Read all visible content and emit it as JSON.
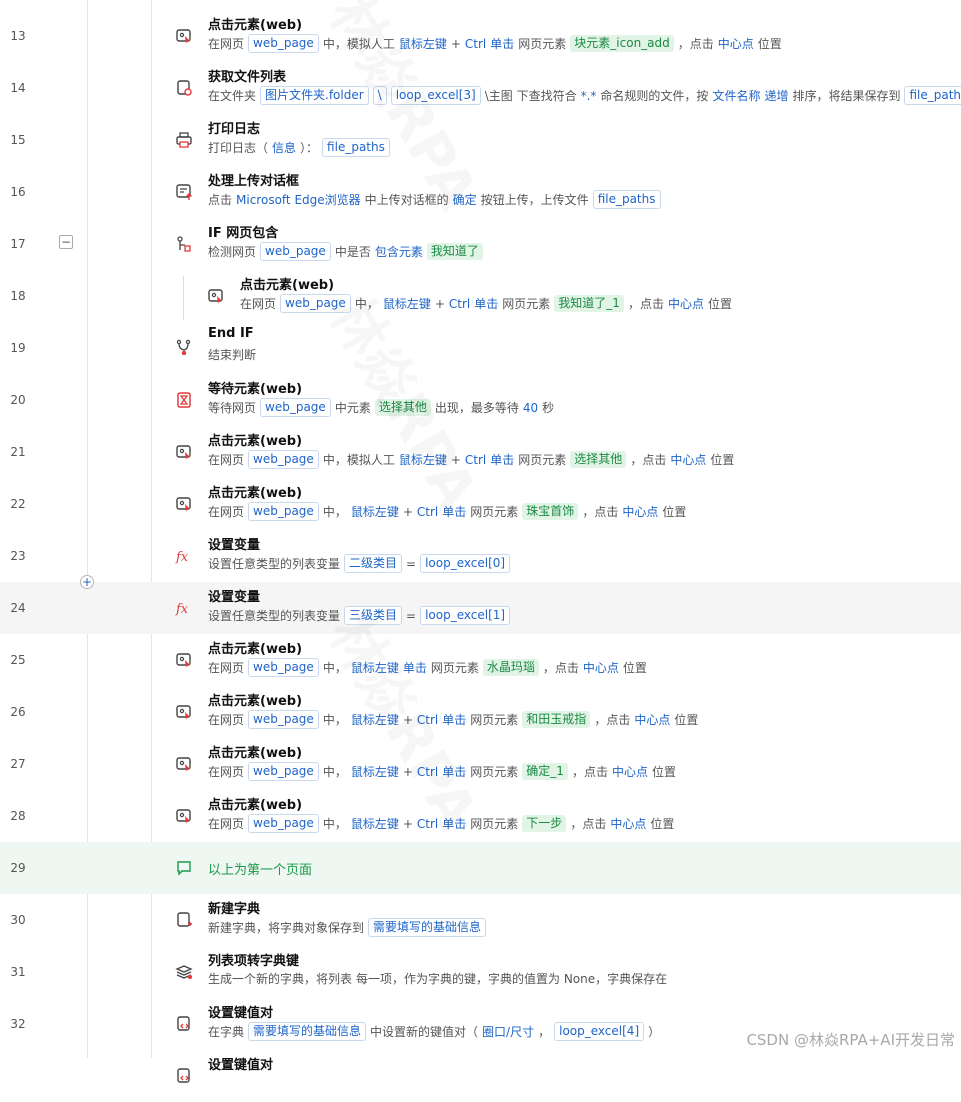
{
  "rows": [
    {
      "num": "13",
      "title": "点击元素(web)",
      "desc": [
        [
          "t",
          "在网页"
        ],
        [
          "tag",
          "web_page"
        ],
        [
          "t",
          "中，模拟人工"
        ],
        [
          "kw",
          "鼠标左键"
        ],
        [
          "t",
          "+"
        ],
        [
          "kw",
          "Ctrl"
        ],
        [
          "kw",
          "单击"
        ],
        [
          "t",
          "网页元素"
        ],
        [
          "el",
          "块元素_icon_add"
        ],
        [
          "t",
          "，点击"
        ],
        [
          "kw",
          "中心点"
        ],
        [
          "t",
          "位置"
        ]
      ]
    },
    {
      "num": "14",
      "title": "获取文件列表",
      "desc": [
        [
          "t",
          "在文件夹"
        ],
        [
          "tag",
          "图片文件夹.folder"
        ],
        [
          "tag",
          "\\"
        ],
        [
          "tag",
          "loop_excel[3]"
        ],
        [
          "t",
          "\\主图 下查找符合"
        ],
        [
          "kw",
          "*.*"
        ],
        [
          "t",
          "命名规则的文件，按"
        ],
        [
          "kw",
          "文件名称"
        ],
        [
          "kw",
          "递增"
        ],
        [
          "t",
          "排序，将结果保存到"
        ],
        [
          "tag",
          "file_paths"
        ]
      ]
    },
    {
      "num": "15",
      "title": "打印日志",
      "desc": [
        [
          "t",
          "打印日志（"
        ],
        [
          "kw",
          "信息"
        ],
        [
          "t",
          "）："
        ],
        [
          "tag",
          "file_paths"
        ]
      ]
    },
    {
      "num": "16",
      "title": "处理上传对话框",
      "desc": [
        [
          "t",
          "点击"
        ],
        [
          "kw",
          "Microsoft Edge浏览器"
        ],
        [
          "t",
          "中上传对话框的"
        ],
        [
          "kw",
          "确定"
        ],
        [
          "t",
          "按钮上传，上传文件"
        ],
        [
          "tag",
          "file_paths"
        ]
      ]
    },
    {
      "num": "17",
      "title": "IF 网页包含",
      "desc": [
        [
          "t",
          "检测网页"
        ],
        [
          "tag",
          "web_page"
        ],
        [
          "t",
          "中是否"
        ],
        [
          "kw",
          "包含元素"
        ],
        [
          "el",
          "我知道了"
        ]
      ]
    },
    {
      "num": "18",
      "title": "点击元素(web)",
      "desc": [
        [
          "t",
          "在网页"
        ],
        [
          "tag",
          "web_page"
        ],
        [
          "t",
          "中，"
        ],
        [
          "kw",
          "鼠标左键"
        ],
        [
          "t",
          "+"
        ],
        [
          "kw",
          "Ctrl"
        ],
        [
          "kw",
          "单击"
        ],
        [
          "t",
          "网页元素"
        ],
        [
          "el",
          "我知道了_1"
        ],
        [
          "t",
          "，点击"
        ],
        [
          "kw",
          "中心点"
        ],
        [
          "t",
          "位置"
        ]
      ]
    },
    {
      "num": "19",
      "title": "End IF",
      "desc": [
        [
          "t",
          "结束判断"
        ]
      ]
    },
    {
      "num": "20",
      "title": "等待元素(web)",
      "desc": [
        [
          "t",
          "等待网页"
        ],
        [
          "tag",
          "web_page"
        ],
        [
          "t",
          "中元素"
        ],
        [
          "el",
          "选择其他"
        ],
        [
          "t",
          "出现，最多等待"
        ],
        [
          "kw",
          "40"
        ],
        [
          "t",
          "秒"
        ]
      ]
    },
    {
      "num": "21",
      "title": "点击元素(web)",
      "desc": [
        [
          "t",
          "在网页"
        ],
        [
          "tag",
          "web_page"
        ],
        [
          "t",
          "中，模拟人工"
        ],
        [
          "kw",
          "鼠标左键"
        ],
        [
          "t",
          "+"
        ],
        [
          "kw",
          "Ctrl"
        ],
        [
          "kw",
          "单击"
        ],
        [
          "t",
          "网页元素"
        ],
        [
          "el",
          "选择其他"
        ],
        [
          "t",
          "，点击"
        ],
        [
          "kw",
          "中心点"
        ],
        [
          "t",
          "位置"
        ]
      ]
    },
    {
      "num": "22",
      "title": "点击元素(web)",
      "desc": [
        [
          "t",
          "在网页"
        ],
        [
          "tag",
          "web_page"
        ],
        [
          "t",
          "中，"
        ],
        [
          "kw",
          "鼠标左键"
        ],
        [
          "t",
          "+"
        ],
        [
          "kw",
          "Ctrl"
        ],
        [
          "kw",
          "单击"
        ],
        [
          "t",
          "网页元素"
        ],
        [
          "el",
          "珠宝首饰"
        ],
        [
          "t",
          "，点击"
        ],
        [
          "kw",
          "中心点"
        ],
        [
          "t",
          "位置"
        ]
      ]
    },
    {
      "num": "23",
      "title": "设置变量",
      "desc": [
        [
          "t",
          "设置任意类型的列表变量"
        ],
        [
          "tag",
          "二级类目"
        ],
        [
          "t",
          "="
        ],
        [
          "tag",
          "loop_excel[0]"
        ]
      ]
    },
    {
      "num": "24",
      "title": "设置变量",
      "desc": [
        [
          "t",
          "设置任意类型的列表变量"
        ],
        [
          "tag",
          "三级类目"
        ],
        [
          "t",
          "="
        ],
        [
          "tag",
          "loop_excel[1]"
        ]
      ]
    },
    {
      "num": "25",
      "title": "点击元素(web)",
      "desc": [
        [
          "t",
          "在网页"
        ],
        [
          "tag",
          "web_page"
        ],
        [
          "t",
          "中，"
        ],
        [
          "kw",
          "鼠标左键"
        ],
        [
          "kw",
          "单击"
        ],
        [
          "t",
          "网页元素"
        ],
        [
          "el",
          "水晶玛瑙"
        ],
        [
          "t",
          "，点击"
        ],
        [
          "kw",
          "中心点"
        ],
        [
          "t",
          "位置"
        ]
      ]
    },
    {
      "num": "26",
      "title": "点击元素(web)",
      "desc": [
        [
          "t",
          "在网页"
        ],
        [
          "tag",
          "web_page"
        ],
        [
          "t",
          "中，"
        ],
        [
          "kw",
          "鼠标左键"
        ],
        [
          "t",
          "+"
        ],
        [
          "kw",
          "Ctrl"
        ],
        [
          "kw",
          "单击"
        ],
        [
          "t",
          "网页元素"
        ],
        [
          "el",
          "和田玉戒指"
        ],
        [
          "t",
          "，点击"
        ],
        [
          "kw",
          "中心点"
        ],
        [
          "t",
          "位置"
        ]
      ]
    },
    {
      "num": "27",
      "title": "点击元素(web)",
      "desc": [
        [
          "t",
          "在网页"
        ],
        [
          "tag",
          "web_page"
        ],
        [
          "t",
          "中，"
        ],
        [
          "kw",
          "鼠标左键"
        ],
        [
          "t",
          "+"
        ],
        [
          "kw",
          "Ctrl"
        ],
        [
          "kw",
          "单击"
        ],
        [
          "t",
          "网页元素"
        ],
        [
          "el",
          "确定_1"
        ],
        [
          "t",
          "，点击"
        ],
        [
          "kw",
          "中心点"
        ],
        [
          "t",
          "位置"
        ]
      ]
    },
    {
      "num": "28",
      "title": "点击元素(web)",
      "desc": [
        [
          "t",
          "在网页"
        ],
        [
          "tag",
          "web_page"
        ],
        [
          "t",
          "中，"
        ],
        [
          "kw",
          "鼠标左键"
        ],
        [
          "t",
          "+"
        ],
        [
          "kw",
          "Ctrl"
        ],
        [
          "kw",
          "单击"
        ],
        [
          "t",
          "网页元素"
        ],
        [
          "el",
          "下一步"
        ],
        [
          "t",
          "，点击"
        ],
        [
          "kw",
          "中心点"
        ],
        [
          "t",
          "位置"
        ]
      ]
    },
    {
      "num": "29",
      "comment": "以上为第一个页面"
    },
    {
      "num": "30",
      "title": "新建字典",
      "desc": [
        [
          "t",
          "新建字典，将字典对象保存到"
        ],
        [
          "tag",
          "需要填写的基础信息"
        ]
      ]
    },
    {
      "num": "31",
      "title": "列表项转字典键",
      "desc": [
        [
          "t",
          "生成一个新的字典，将列表"
        ],
        [
          "t",
          "每一项，作为字典的键，字典的值置为 None，字典保存在"
        ]
      ]
    },
    {
      "num": "32",
      "title": "设置键值对",
      "desc": [
        [
          "t",
          "在字典"
        ],
        [
          "tag",
          "需要填写的基础信息"
        ],
        [
          "t",
          "中设置新的键值对（"
        ],
        [
          "kw",
          "圈口/尺寸"
        ],
        [
          "t",
          "，"
        ],
        [
          "tag",
          "loop_excel[4]"
        ],
        [
          "t",
          "）"
        ]
      ]
    },
    {
      "num": "",
      "title": "设置键值对",
      "desc": []
    }
  ],
  "watermark": "CSDN @林焱RPA+AI开发日常",
  "bg_watermark": "林焱RPA"
}
